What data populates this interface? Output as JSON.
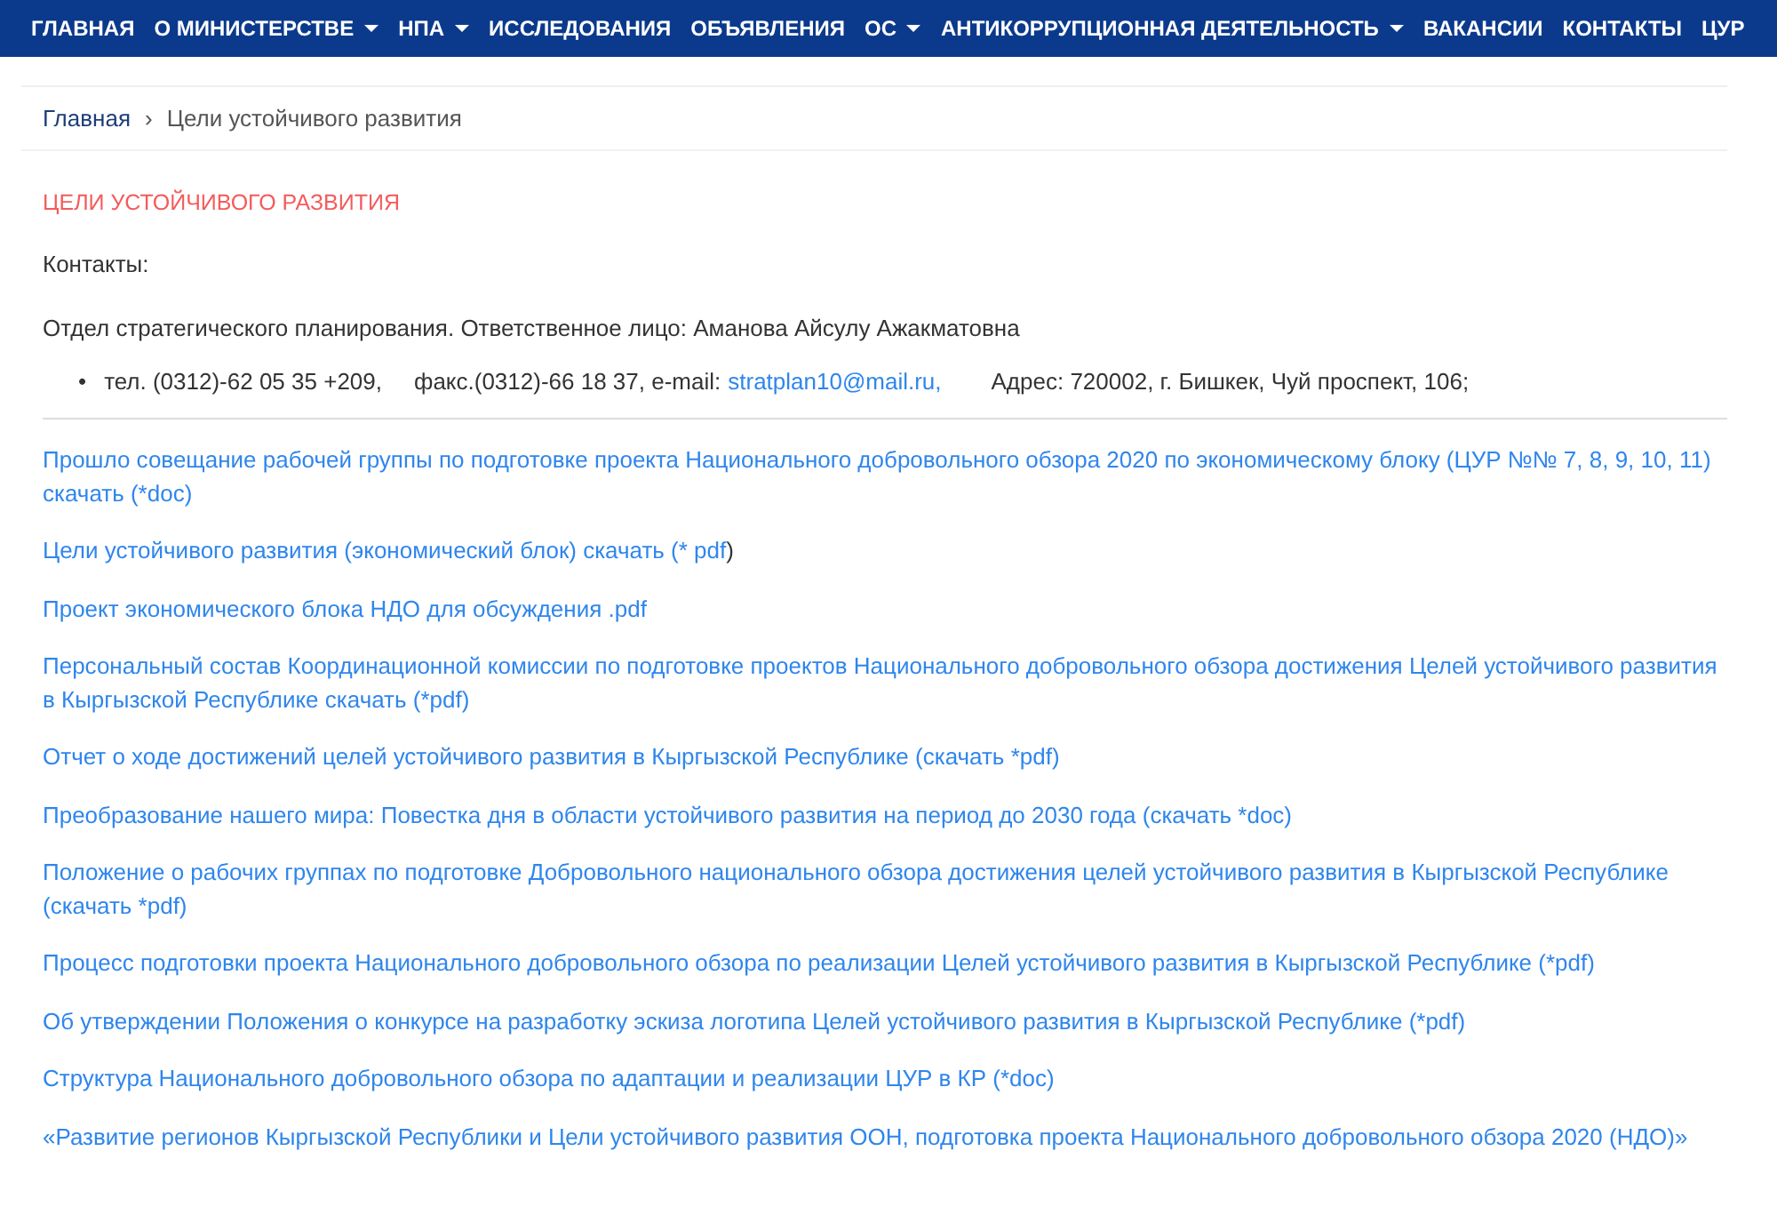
{
  "nav": [
    {
      "label": "ГЛАВНАЯ",
      "dropdown": false
    },
    {
      "label": "О МИНИСТЕРСТВЕ",
      "dropdown": true
    },
    {
      "label": "НПА",
      "dropdown": true
    },
    {
      "label": "ИССЛЕДОВАНИЯ",
      "dropdown": false
    },
    {
      "label": "ОБЪЯВЛЕНИЯ",
      "dropdown": false
    },
    {
      "label": "ОС",
      "dropdown": true
    },
    {
      "label": "АНТИКОРРУПЦИОННАЯ ДЕЯТЕЛЬНОСТЬ",
      "dropdown": true
    },
    {
      "label": "ВАКАНСИИ",
      "dropdown": false
    },
    {
      "label": "КОНТАКТЫ",
      "dropdown": false
    },
    {
      "label": "ЦУР",
      "dropdown": false
    }
  ],
  "breadcrumb": {
    "home": "Главная",
    "separator": "›",
    "current": "Цели устойчивого развития"
  },
  "page_title": "ЦЕЛИ УСТОЙЧИВОГО РАЗВИТИЯ",
  "contacts_label": "Контакты:",
  "department": "Отдел стратегического планирования. Ответственное лицо: Аманова Айсулу Ажакматовна",
  "contact_line": {
    "bullet": "•",
    "phone": "тел. (0312)-62 05 35 +209,",
    "fax": "факс.(0312)-66 18 37, e-mail:",
    "email": "stratplan10@mail.ru,",
    "address": "Адрес: 720002, г. Бишкек, Чуй проспект, 106;"
  },
  "documents": [
    {
      "link": "Прошло совещание рабочей группы по подготовке проекта Национального добровольного обзора 2020 по экономическому блоку (ЦУР №№ 7, 8, 9, 10, 11) скачать (*doc)"
    },
    {
      "link": "Цели устойчивого развития (экономический блок) скачать (* pdf",
      "after": ")"
    },
    {
      "link": "Проект экономического блока НДО для обсуждения .pdf"
    },
    {
      "link": "Персональный состав Координационной комиссии по подготовке проектов Национального добровольного обзора достижения Целей устойчивого развития в Кыргызской Республике скачать (*pdf)"
    },
    {
      "link": "Отчет о ходе достижений целей устойчивого развития в Кыргызской Республике (скачать *pdf)"
    },
    {
      "link": "Преобразование нашего мира: Повестка дня в области устойчивого развития на период до 2030 года  (скачать *doc)"
    },
    {
      "link": "Положение о рабочих группах по подготовке Добровольного национального обзора достижения целей устойчивого развития в Кыргызской Республике (скачать *pdf)"
    },
    {
      "link": "Процесс подготовки проекта Национального добровольного обзора по реализации  Целей устойчивого развития в Кыргызской Республике (*pdf)"
    },
    {
      "link": "Об утверждении Положения о конкурсе на разработку эскиза логотипа Целей устойчивого развития в Кыргызской Республике (*pdf)"
    },
    {
      "link": "Структура Национального добровольного обзора по адаптации и реализации ЦУР в КР (*doc)"
    },
    {
      "link": "«Развитие регионов Кыргызской Республики и Цели устойчивого развития ООН, подготовка проекта Национального добровольного обзора 2020 (НДО)»"
    }
  ]
}
